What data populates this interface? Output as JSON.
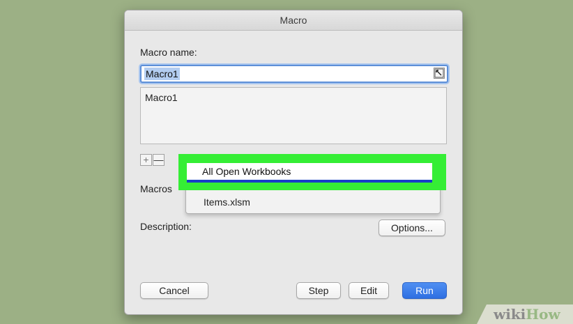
{
  "window": {
    "title": "Macro"
  },
  "form": {
    "macro_name_label": "Macro name:",
    "macro_name_value": "Macro1",
    "macro_list": [
      "Macro1"
    ],
    "add_symbol": "+",
    "remove_symbol": "—",
    "macros_in_label": "Macros",
    "description_label": "Description:"
  },
  "dropdown": {
    "selected": "All Open Workbooks",
    "options": [
      "All Open Workbooks",
      "Items.xlsm"
    ]
  },
  "buttons": {
    "options": "Options...",
    "cancel": "Cancel",
    "step": "Step",
    "edit": "Edit",
    "run": "Run"
  },
  "watermark": {
    "wiki": "wiki",
    "how": "How"
  },
  "colors": {
    "highlight": "#35ee35",
    "run_button": "#2e6fe2",
    "background": "#9cb085"
  }
}
